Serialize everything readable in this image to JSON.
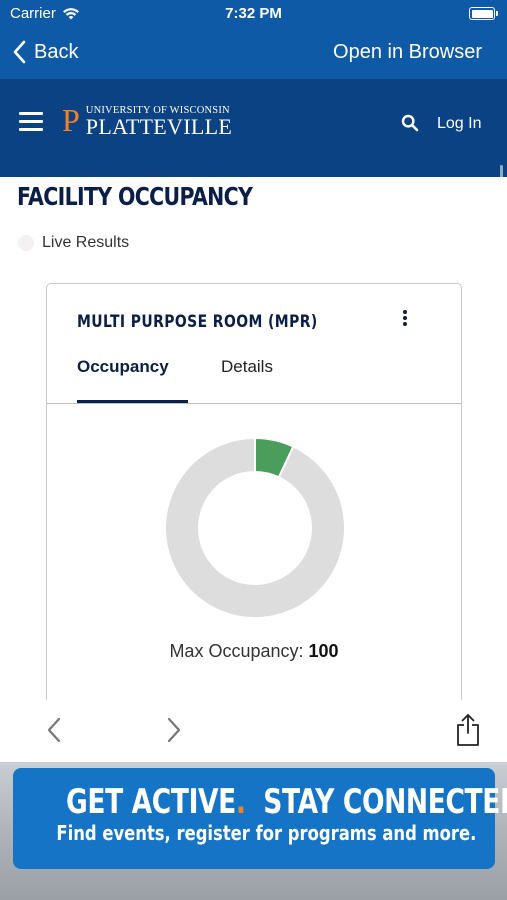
{
  "status_bar": {
    "carrier": "Carrier",
    "time": "7:32 PM"
  },
  "nav": {
    "back_label": "Back",
    "open_browser_label": "Open in Browser"
  },
  "site_header": {
    "logo_letter": "P",
    "logo_line1": "UNIVERSITY OF WISCONSIN",
    "logo_line2": "PLATTEVILLE",
    "login_label": "Log In"
  },
  "page": {
    "title": "FACILITY OCCUPANCY",
    "live_label": "Live Results"
  },
  "card": {
    "title": "MULTI PURPOSE ROOM (MPR)",
    "tabs": [
      {
        "label": "Occupancy"
      },
      {
        "label": "Details"
      }
    ],
    "max_occupancy_label": "Max Occupancy:",
    "max_occupancy_value": "100"
  },
  "chart_data": {
    "type": "pie",
    "values": [
      7,
      93
    ],
    "colors": [
      "#4a9d5b",
      "#dddddd"
    ]
  },
  "banner": {
    "line1_part1": "GET ACTIVE",
    "line1_part2": "STAY CONNECTED",
    "dot": ".",
    "line2": "Find events, register for programs and more."
  },
  "colors": {
    "nav_blue": "#0f5aa7",
    "header_navy": "#0b4283",
    "accent_orange": "#f58025",
    "occupied_green": "#4a9d5b"
  }
}
